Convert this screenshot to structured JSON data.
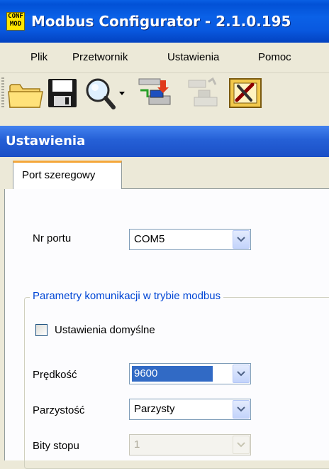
{
  "window": {
    "icon_text_top": "CONF",
    "icon_text_bottom": "MOD",
    "title": "Modbus Configurator - 2.1.0.195"
  },
  "menu": {
    "items": [
      {
        "label": "Plik"
      },
      {
        "label": "Przetwornik"
      },
      {
        "label": "Ustawienia"
      },
      {
        "label": "Pomoc"
      }
    ]
  },
  "toolbar": {
    "buttons": [
      "open-folder-icon",
      "save-disk-icon",
      "search-magnifier-icon",
      "read-device-icon",
      "write-device-icon",
      "configure-tools-icon"
    ]
  },
  "panel": {
    "title": "Ustawienia"
  },
  "tabs": [
    {
      "label": "Port szeregowy",
      "active": true
    }
  ],
  "form": {
    "port_label": "Nr portu",
    "port_value": "COM5",
    "group_title": "Parametry komunikacji w trybie modbus",
    "default_checkbox_label": "Ustawienia domyślne",
    "default_checked": false,
    "speed_label": "Prędkość",
    "speed_value": "9600",
    "parity_label": "Parzystość",
    "parity_value": "Parzysty",
    "stopbits_label": "Bity stopu",
    "stopbits_value": "1"
  },
  "colors": {
    "titlebar": "#0a5fe3",
    "panel_header": "#2560d6",
    "group_title": "#0046d5",
    "selection": "#316ac5",
    "tab_highlight": "#f5a73b"
  }
}
